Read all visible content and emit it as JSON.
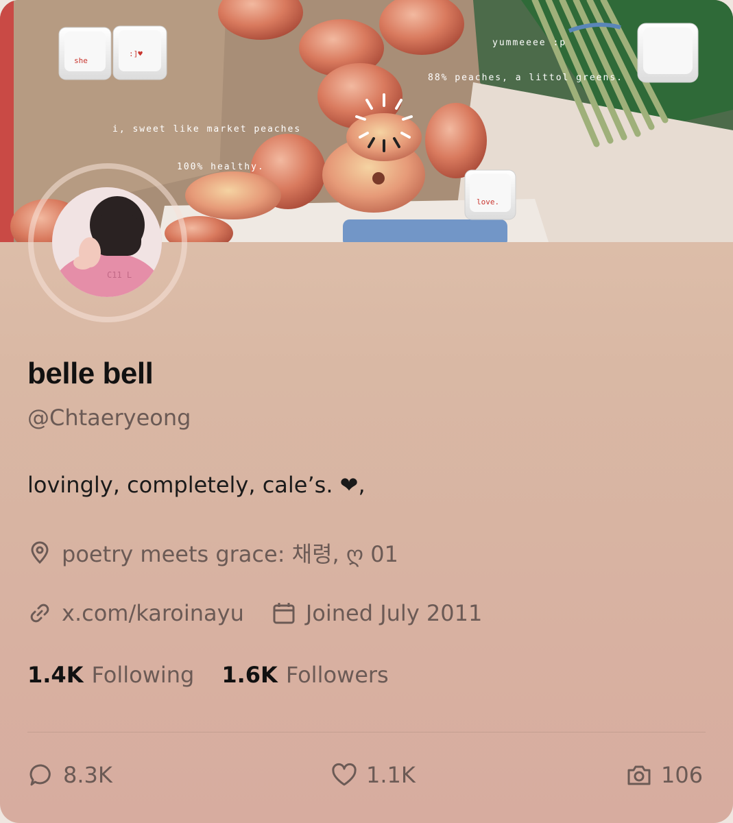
{
  "banner": {
    "keycaps": [
      "she",
      ":]♥",
      "love."
    ],
    "notes": [
      "yummeeee :p",
      "88% peaches, a littol greens.",
      "i, sweet like market peaches",
      "100% healthy."
    ]
  },
  "profile": {
    "display_name": "belle bell",
    "handle": "@Chtaeryeong",
    "bio": "lovingly, completely, cale’s. ❤,",
    "location": "poetry meets grace: 채령, ღ 01",
    "website": "x.com/karoinayu",
    "joined": "Joined July 2011"
  },
  "stats": {
    "following_count": "1.4K",
    "following_label": "Following",
    "followers_count": "1.6K",
    "followers_label": "Followers"
  },
  "actions": {
    "replies": "8.3K",
    "likes": "1.1K",
    "media": "106"
  },
  "icons": {
    "location": "location-pin-icon",
    "link": "link-icon",
    "calendar": "calendar-icon",
    "reply": "speech-bubble-icon",
    "like": "heart-icon",
    "media": "camera-icon"
  },
  "colors": {
    "card_top": "#e3c7b2",
    "card_bottom": "#d7ac9f",
    "text_primary": "#111111",
    "text_secondary": "#6b5a55"
  }
}
